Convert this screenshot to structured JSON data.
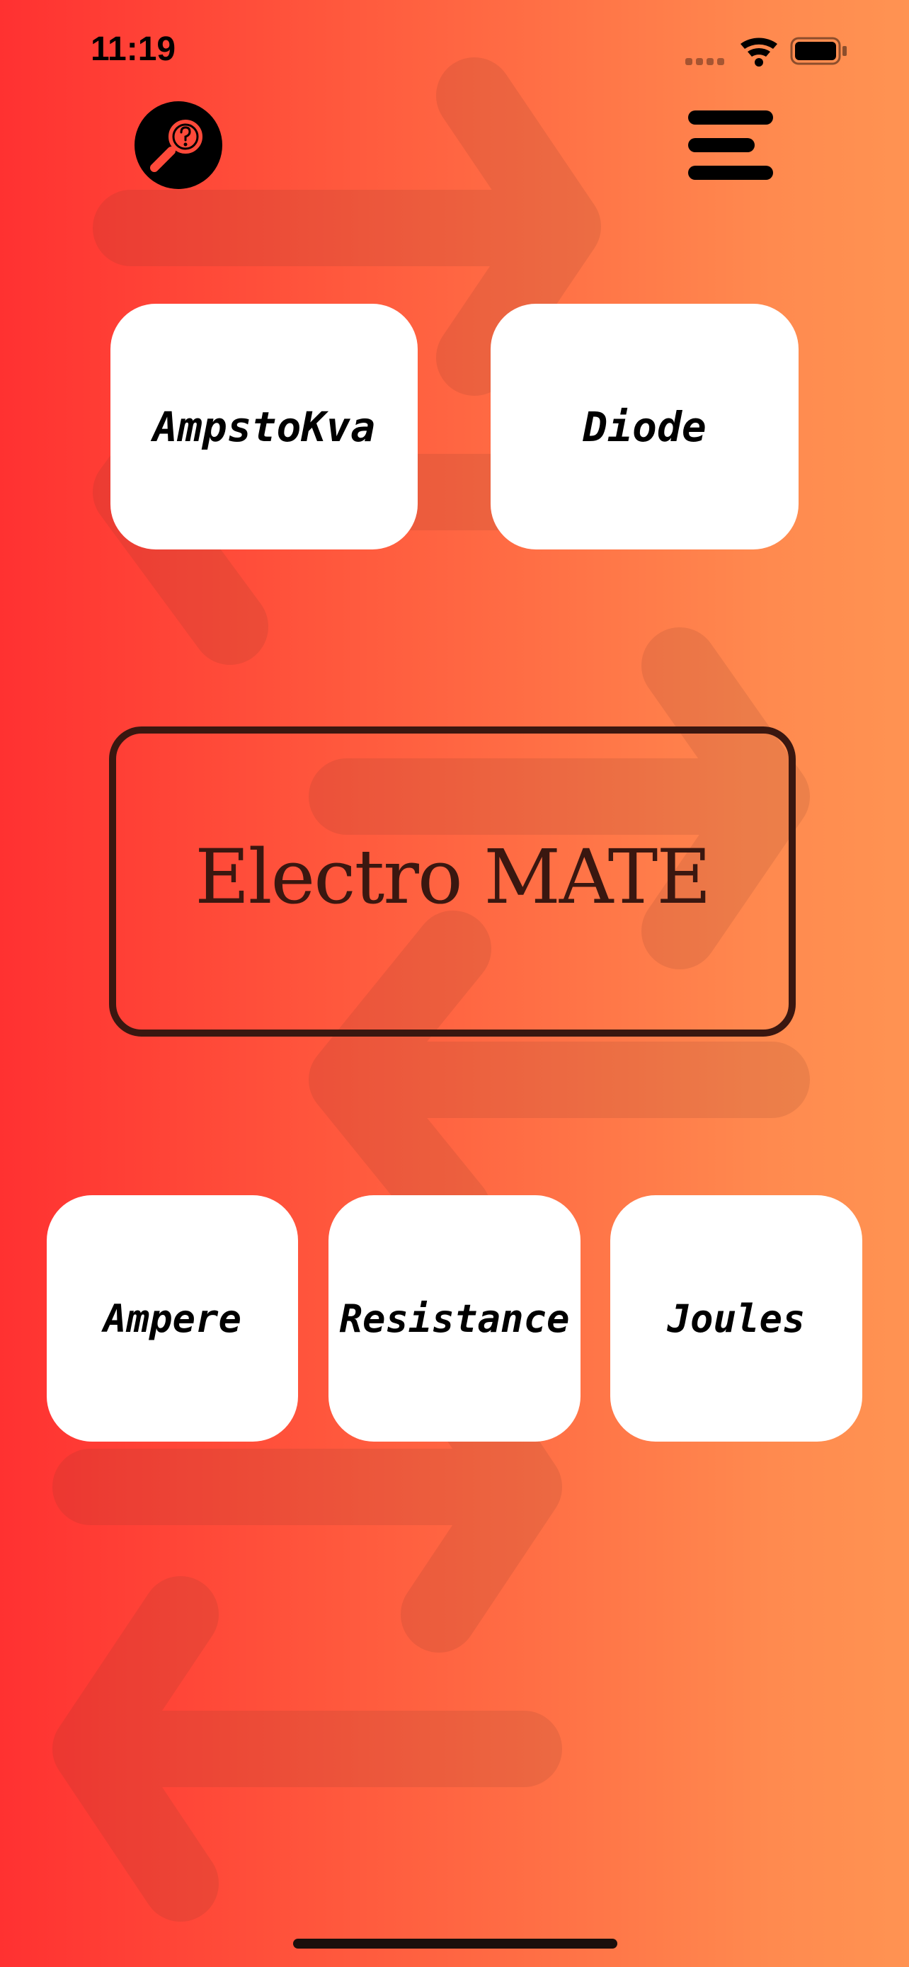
{
  "status_bar": {
    "time": "11:19",
    "icons": [
      "signal-icon",
      "wifi-icon",
      "battery-icon"
    ]
  },
  "header": {
    "help_icon": "help-search-icon",
    "menu_icon": "hamburger-menu-icon"
  },
  "top_cards": [
    {
      "label": "AmpstoKva"
    },
    {
      "label": "Diode"
    }
  ],
  "title": "Electro MATE",
  "bottom_cards": [
    {
      "label": "Ampere"
    },
    {
      "label": "Resistance"
    },
    {
      "label": "Joules"
    }
  ],
  "colors": {
    "gradient_left": "#ff3131",
    "gradient_right": "#ff9352",
    "card": "#ffffff",
    "title": "#3a1710"
  }
}
